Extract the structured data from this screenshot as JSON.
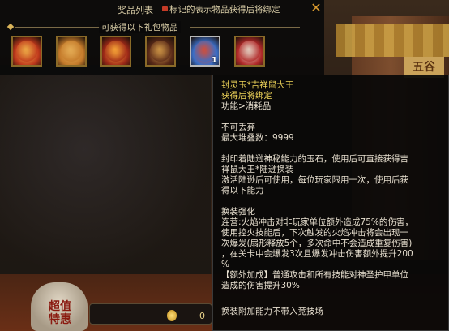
{
  "panel": {
    "title": "奖品列表",
    "lock_note": "标记的表示物品获得后将绑定",
    "close_label": "✕",
    "section_title": "可获得以下礼包物品",
    "items": [
      {
        "name": "lucky-mouse-pack-red",
        "color": "#c0391c",
        "accent": "#f1b64a",
        "badge": ""
      },
      {
        "name": "chest-orange",
        "color": "#c47a2a",
        "accent": "#e8b25a",
        "badge": ""
      },
      {
        "name": "fire-figure",
        "color": "#a02a18",
        "accent": "#ffb03a",
        "badge": ""
      },
      {
        "name": "lucky-mouse-pack-dark",
        "color": "#5a2a18",
        "accent": "#d9a04a",
        "badge": ""
      },
      {
        "name": "fire-jade-orb",
        "color": "#3b6ec6",
        "accent": "#e24a2a",
        "badge": "1"
      },
      {
        "name": "mouse-king-mask",
        "color": "#b22a2a",
        "accent": "#e8e0d0",
        "badge": ""
      }
    ]
  },
  "tooltip": {
    "name": "封灵玉*吉祥鼠大王",
    "bind": "获得后将绑定",
    "type": "功能>消耗品",
    "not_discard": "不可丢弃",
    "max_stack": "最大堆叠数：9999",
    "desc1_line1": "封印着陆逊神秘能力的玉石，使用后可直接获得吉",
    "desc1_line2": "祥鼠大王*陆逊换装",
    "desc2_line1": "激活陆逊后可使用，每位玩家限用一次，使用后获",
    "desc2_line2": "得以下能力",
    "enhance_title": "换装强化",
    "enh_l1": "连营:火焰冲击对非玩家单位额外造成75%的伤害，",
    "enh_l2": "使用控火技能后，下次触发的火焰冲击将会出现一",
    "enh_l3": "次爆发(扇形释放5个，多次命中不会造成重复伤害)",
    "enh_l4": "，在关卡中会爆发3次且爆发冲击伤害额外提升200",
    "enh_l5": "%",
    "extra_l1": "【额外加成】普通攻击和所有技能对神圣护甲单位",
    "extra_l2": "造成的伤害提升30%",
    "footer": "换装附加能力不带入竞技场"
  },
  "background": {
    "stall_sign": "五谷",
    "jar_text_1": "超值",
    "jar_text_2": "特惠",
    "counter": "0"
  }
}
